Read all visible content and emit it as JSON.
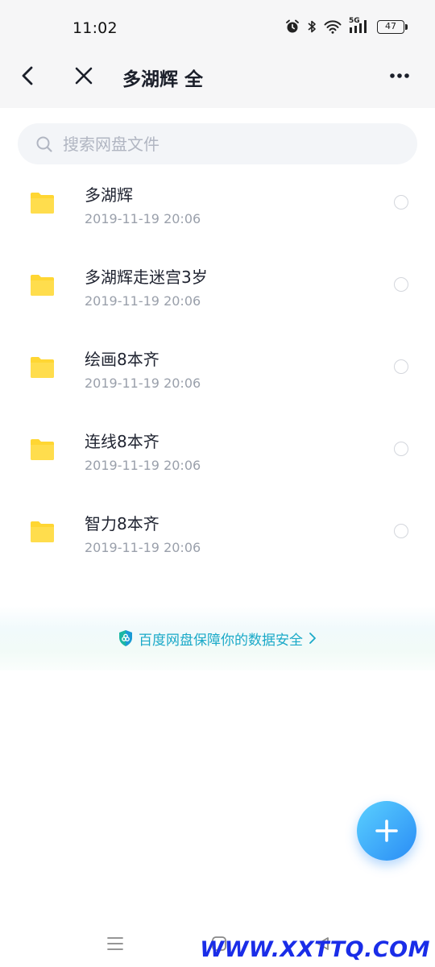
{
  "status_bar": {
    "time": "11:02",
    "network": "5G",
    "battery": "47"
  },
  "nav": {
    "title": "多湖辉 全"
  },
  "search": {
    "placeholder": "搜索网盘文件",
    "value": ""
  },
  "files": [
    {
      "name": "多湖辉",
      "date": "2019-11-19  20:06"
    },
    {
      "name": "多湖辉走迷宫3岁",
      "date": "2019-11-19  20:06"
    },
    {
      "name": "绘画8本齐",
      "date": "2019-11-19  20:06"
    },
    {
      "name": "连线8本齐",
      "date": "2019-11-19  20:06"
    },
    {
      "name": "智力8本齐",
      "date": "2019-11-19  20:06"
    }
  ],
  "security_banner": {
    "text": "百度网盘保障你的数据安全"
  },
  "watermark": "WWW.XXTTQ.COM",
  "colors": {
    "folder": "#ffd633",
    "accent": "#1aa9c8",
    "fab_start": "#5ad0ff",
    "fab_end": "#2a8cf5",
    "watermark": "#1a2de8"
  }
}
